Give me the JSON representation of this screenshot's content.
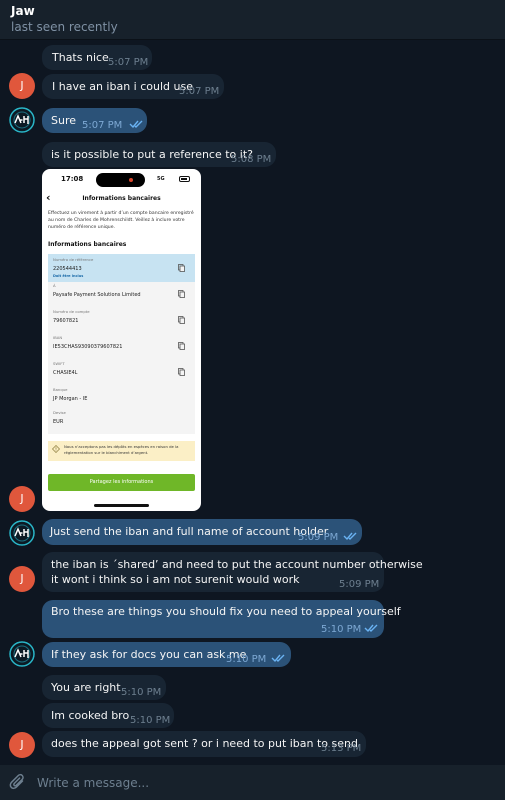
{
  "chat": {
    "contact_name": "Jaw",
    "contact_status": "last seen recently",
    "composer_placeholder": "Write a message..."
  },
  "messages": [
    {
      "text": "Thats nice",
      "time": "5:07 PM",
      "direction": "incoming"
    },
    {
      "text": "I have an iban i could use",
      "time": "5:07 PM",
      "direction": "incoming"
    },
    {
      "text": "Sure",
      "time": "5:07 PM",
      "direction": "outgoing",
      "read": true
    },
    {
      "text": "is it possible to put a reference to it?",
      "time": "5:08 PM",
      "direction": "incoming"
    },
    {
      "text": "Just send the iban and full name of account holder",
      "time": "5:09 PM",
      "direction": "outgoing",
      "read": true
    },
    {
      "lines": [
        "the iban is ´shared’ and need to put the account number otherwise",
        "it wont i think so i am not surenit would work"
      ],
      "time": "5:09 PM",
      "direction": "incoming"
    },
    {
      "text": "Bro these are things you should fix you need to appeal yourself",
      "time": "5:10 PM",
      "direction": "outgoing",
      "read": true
    },
    {
      "text": "If they ask for docs you can ask me",
      "time": "5:10 PM",
      "direction": "outgoing",
      "read": true
    },
    {
      "text": "You are right",
      "time": "5:10 PM",
      "direction": "incoming"
    },
    {
      "text": "Im cooked bro",
      "time": "5:10 PM",
      "direction": "incoming"
    },
    {
      "text": "does the appeal got sent ? or i need to put iban to send",
      "time": "5:13 PM",
      "direction": "incoming"
    }
  ],
  "avatars": {
    "incoming_initial": "J"
  },
  "screenshot": {
    "clock": "17:08",
    "network": "5G",
    "title": "Informations bancaires",
    "description": "Effectuez un virement à partir d’un compte bancaire enregistré au nom de Charles de Mohrenschildt. Veillez à inclure votre numéro de référence unique.",
    "section": "Informations bancaires",
    "fields": [
      {
        "label": "Numéro de référence",
        "value": "220544413",
        "note": "Doit être inclus"
      },
      {
        "label": "À",
        "value": "Paysafe Payment Solutions Limited"
      },
      {
        "label": "Numéro de compte",
        "value": "79607821"
      },
      {
        "label": "IBAN",
        "value": "IE53CHAS93090379607821"
      },
      {
        "label": "SWIFT",
        "value": "CHASIE4L"
      },
      {
        "label": "Banque",
        "value": "JP Morgan - IE"
      },
      {
        "label": "Devise",
        "value": "EUR"
      }
    ],
    "notice": "Nous n’acceptons pas les dépôts en espèces en raison de la réglementation sur le blanchiment d’argent.",
    "button": "Partagez les informations"
  },
  "colors": {
    "background": "#0e1621",
    "header": "#17212b",
    "incoming_bubble": "#182533",
    "outgoing_bubble": "#2b5278",
    "avatar": "#e0573c",
    "read_ticks": "#6ab3f3",
    "share_button": "#6fb728"
  },
  "icons": {
    "ticks": "double-check-icon",
    "attach": "paperclip-icon",
    "copy": "copy-icon",
    "back": "chevron-left-icon",
    "warning": "warning-icon"
  }
}
